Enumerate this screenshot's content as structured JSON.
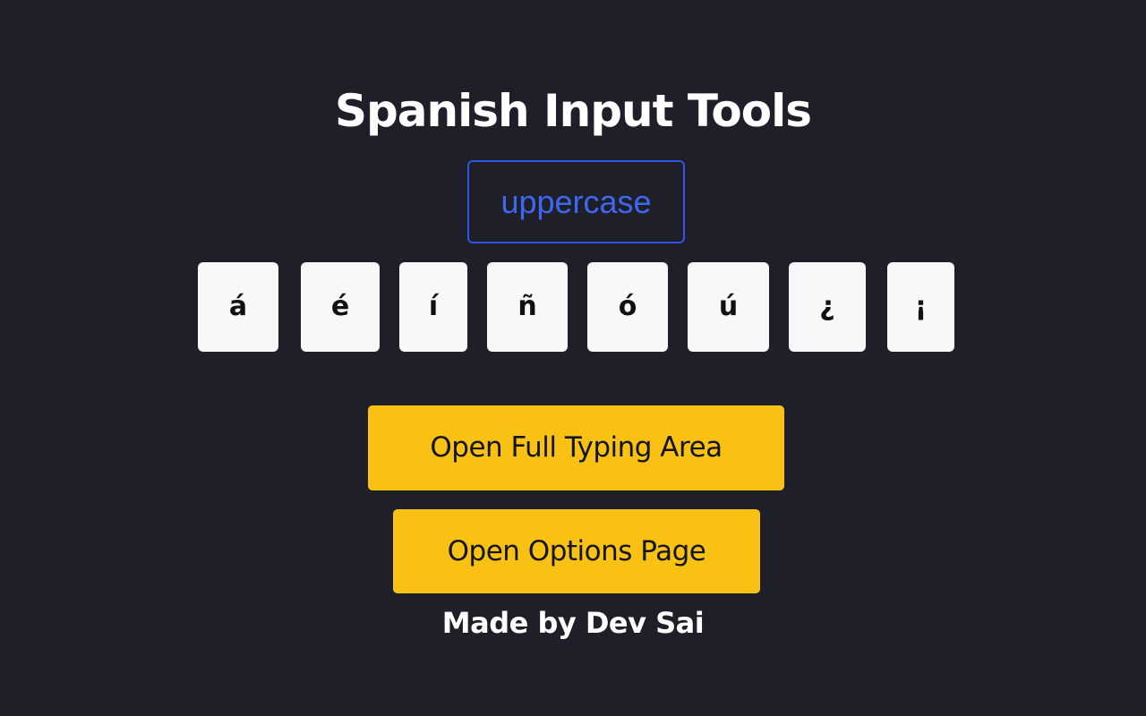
{
  "title": "Spanish Input Tools",
  "case_toggle": {
    "label": "uppercase"
  },
  "keys": [
    "á",
    "é",
    "í",
    "ñ",
    "ó",
    "ú",
    "¿",
    "¡"
  ],
  "buttons": {
    "full_typing_area": "Open Full Typing Area",
    "options_page": "Open Options Page"
  },
  "footer": "Made by Dev Sai",
  "colors": {
    "background": "#1e1f28",
    "accent_blue": "#3056e8",
    "button_yellow": "#f8c114",
    "key_background": "#f7f8fa"
  }
}
